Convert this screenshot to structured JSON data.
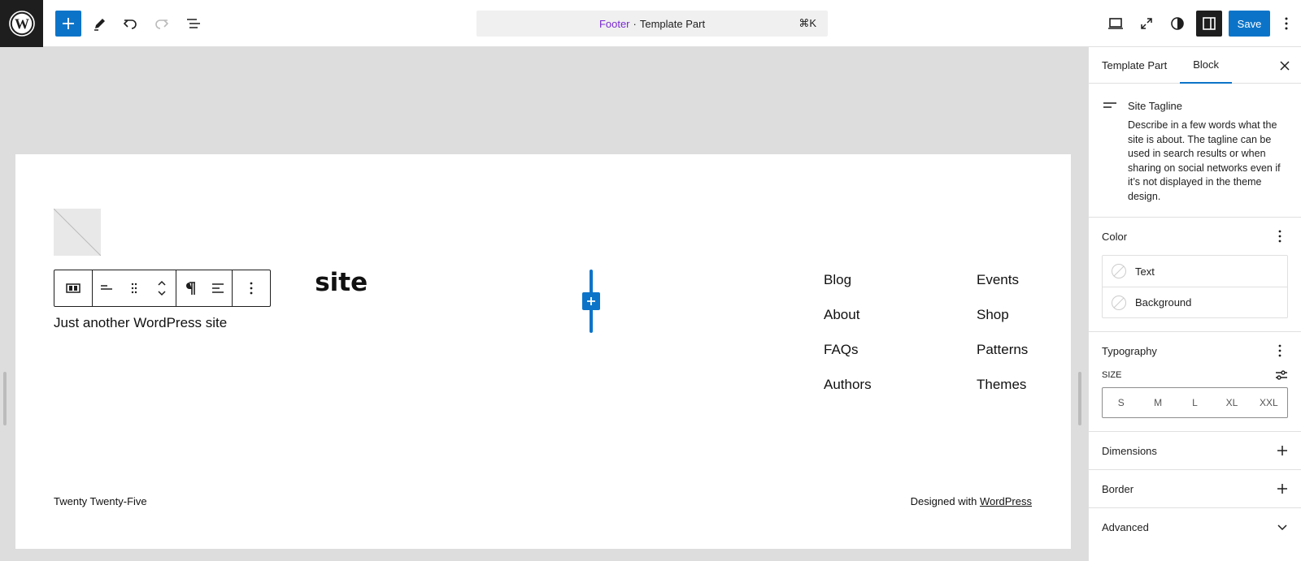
{
  "header": {
    "command_bar": {
      "title": "Footer",
      "separator": "·",
      "subtitle": "Template Part",
      "shortcut": "⌘K"
    },
    "save_label": "Save",
    "accent_color": "#0c74c8",
    "title_color": "#7a2bd1",
    "left_tools": [
      "add-block-icon",
      "tools-pencil-icon",
      "undo-icon",
      "redo-icon",
      "document-overview-icon"
    ],
    "right_tools": [
      "device-preview-icon",
      "fullscreen-icon",
      "styles-contrast-icon",
      "sidebar-toggle-icon",
      "options-icon"
    ]
  },
  "canvas": {
    "site_title_visible": "site",
    "site_tagline": "Just another WordPress site",
    "nav_col1": [
      "Blog",
      "About",
      "FAQs",
      "Authors"
    ],
    "nav_col2": [
      "Events",
      "Shop",
      "Patterns",
      "Themes"
    ],
    "footer_left": "Twenty Twenty-Five",
    "footer_right_prefix": "Designed with ",
    "footer_right_link": "WordPress"
  },
  "block_toolbar": {
    "buttons": [
      "transform-icon",
      "justify-icon",
      "drag-handle-icon",
      "move-up-down-icon",
      "paragraph-icon",
      "align-left-icon",
      "more-options-icon"
    ]
  },
  "sidebar": {
    "tabs": [
      "Template Part",
      "Block"
    ],
    "active_tab": "Block",
    "block_card": {
      "title": "Site Tagline",
      "description": "Describe in a few words what the site is about. The tagline can be used in search results or when sharing on social networks even if it’s not displayed in the theme design."
    },
    "color": {
      "title": "Color",
      "items": [
        "Text",
        "Background"
      ]
    },
    "typography": {
      "title": "Typography",
      "size_label": "SIZE",
      "sizes": [
        "S",
        "M",
        "L",
        "XL",
        "XXL"
      ]
    },
    "dimensions_title": "Dimensions",
    "border_title": "Border",
    "advanced_title": "Advanced"
  }
}
